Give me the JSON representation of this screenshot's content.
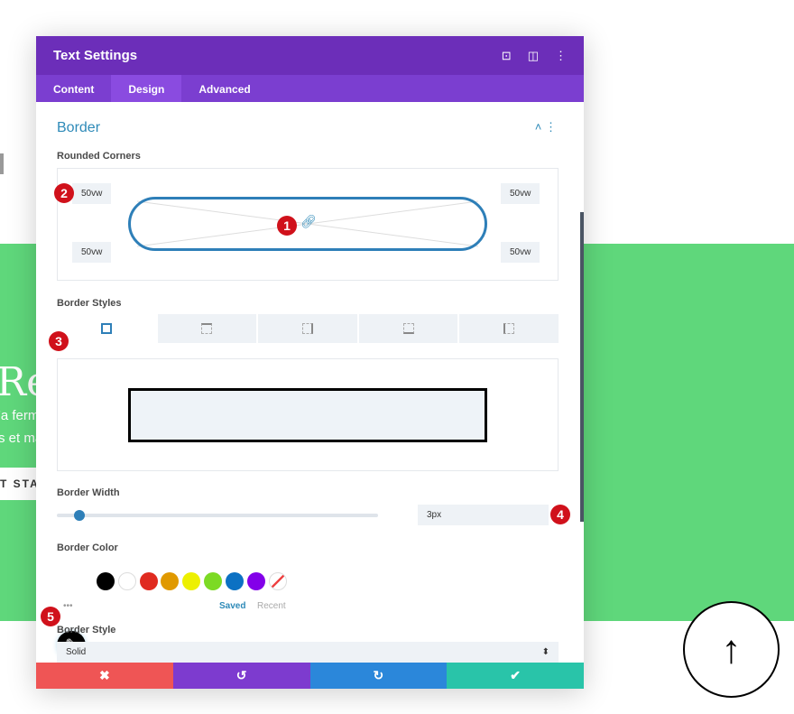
{
  "background": {
    "hero_title": "Re",
    "hero_line1": "'a ferm",
    "hero_line2": "s et ma",
    "hero_button": "T STA",
    "up_arrow": "↑"
  },
  "modal": {
    "title": "Text Settings",
    "tabs": [
      {
        "label": "Content"
      },
      {
        "label": "Design",
        "active": true
      },
      {
        "label": "Advanced"
      }
    ],
    "section_title": "Border",
    "rounded_corners": {
      "label": "Rounded Corners",
      "top_left": "50vw",
      "top_right": "50vw",
      "bottom_left": "50vw",
      "bottom_right": "50vw"
    },
    "border_styles_label": "Border Styles",
    "border_width": {
      "label": "Border Width",
      "value": "3px",
      "slider_fraction": 0.07
    },
    "border_color": {
      "label": "Border Color",
      "swatches": [
        "#000000",
        "#ffffff",
        "#e02b20",
        "#e09900",
        "#edf000",
        "#7cda24",
        "#0c71c3",
        "#8300e9"
      ],
      "saved": "Saved",
      "recent": "Recent",
      "more": "•••"
    },
    "border_style": {
      "label": "Border Style",
      "value": "Solid"
    },
    "footer": {
      "cancel": "✖",
      "undo": "↺",
      "redo": "↻",
      "save": "✔"
    },
    "badges": [
      "1",
      "2",
      "3",
      "4",
      "5"
    ]
  },
  "colors": {
    "header": "#6c2eb9",
    "tabs": "#7b3ed0",
    "green": "#5fd77b",
    "cancel": "#ef5555",
    "undo": "#7d3bcf",
    "redo": "#2b87da",
    "save": "#29c4a9"
  }
}
